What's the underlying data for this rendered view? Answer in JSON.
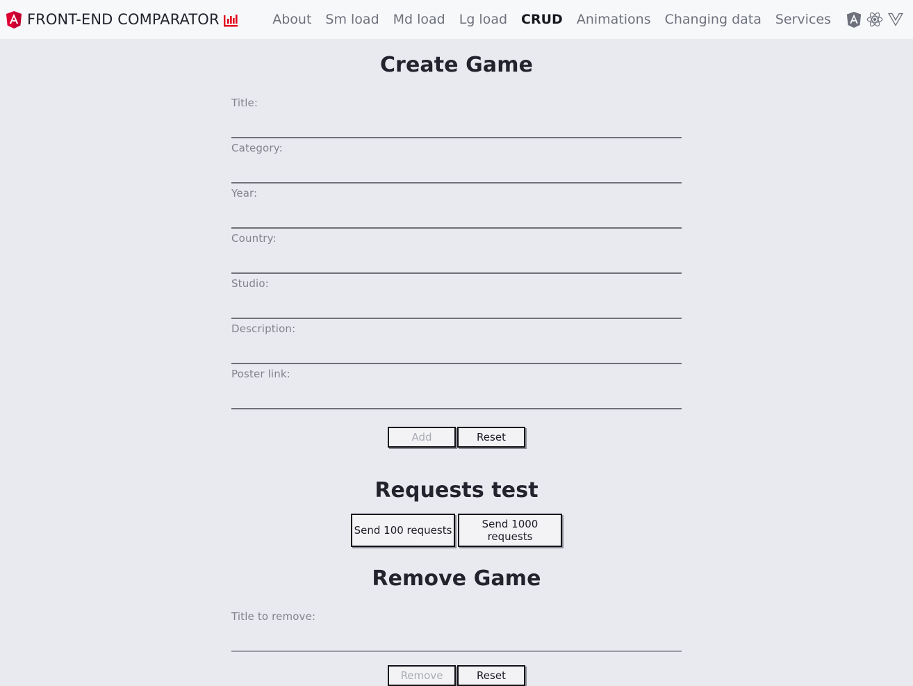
{
  "header": {
    "brand_name": "FRONT-END COMPARATOR",
    "brand_logo_icon": "angular-shield-icon",
    "brand_chart_icon": "bar-chart-icon",
    "accent_color": "#dd0031",
    "background_color": "#f7f8fa",
    "nav": [
      {
        "label": "About",
        "active": false
      },
      {
        "label": "Sm load",
        "active": false
      },
      {
        "label": "Md load",
        "active": false
      },
      {
        "label": "Lg load",
        "active": false
      },
      {
        "label": "CRUD",
        "active": true
      },
      {
        "label": "Animations",
        "active": false
      },
      {
        "label": "Changing data",
        "active": false
      },
      {
        "label": "Services",
        "active": false
      }
    ],
    "framework_icons": [
      {
        "name": "angular-logo-icon",
        "color": "#6e707c"
      },
      {
        "name": "react-logo-icon",
        "color": "#6e707c"
      },
      {
        "name": "vue-logo-icon",
        "color": "#6e707c"
      }
    ]
  },
  "page": {
    "background_color": "#e9eaef"
  },
  "create_game": {
    "title": "Create Game",
    "fields": [
      {
        "label": "Title:",
        "value": "",
        "placeholder": ""
      },
      {
        "label": "Category:",
        "value": "",
        "placeholder": ""
      },
      {
        "label": "Year:",
        "value": "",
        "placeholder": ""
      },
      {
        "label": "Country:",
        "value": "",
        "placeholder": ""
      },
      {
        "label": "Studio:",
        "value": "",
        "placeholder": ""
      },
      {
        "label": "Description:",
        "value": "",
        "placeholder": ""
      },
      {
        "label": "Poster link:",
        "value": "",
        "placeholder": ""
      }
    ],
    "add_label": "Add",
    "add_disabled": true,
    "reset_label": "Reset",
    "reset_disabled": false
  },
  "requests_test": {
    "title": "Requests test",
    "send_100_label": "Send 100 requests",
    "send_1000_label": "Send 1000 requests"
  },
  "remove_game": {
    "title": "Remove Game",
    "field": {
      "label": "Title to remove:",
      "value": "",
      "placeholder": ""
    },
    "remove_label": "Remove",
    "remove_disabled": true,
    "reset_label": "Reset",
    "reset_disabled": false
  }
}
